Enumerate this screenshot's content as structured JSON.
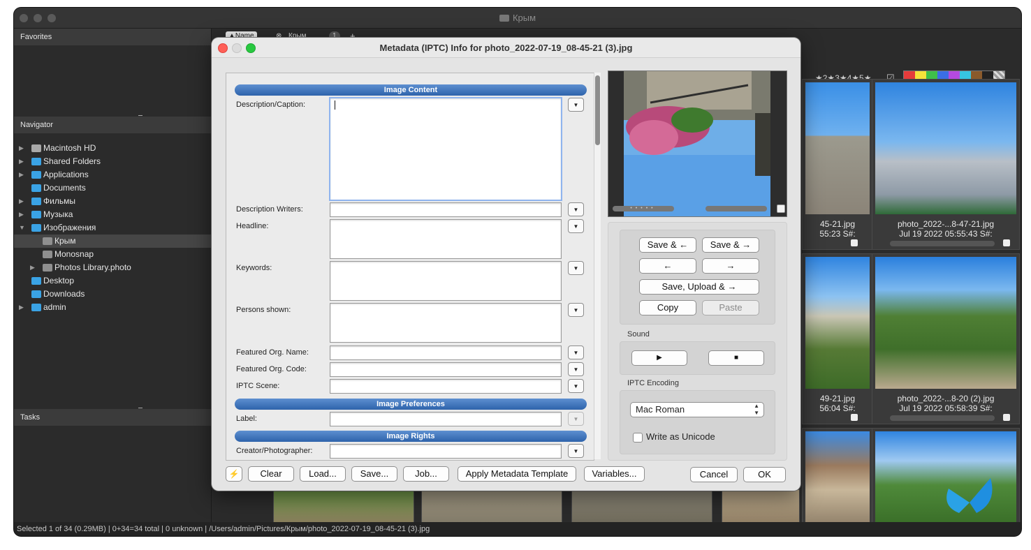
{
  "window": {
    "title": "Крым"
  },
  "panels": {
    "favorites": "Favorites",
    "navigator": "Navigator",
    "tasks": "Tasks"
  },
  "navigator_items": [
    {
      "label": "Macintosh HD",
      "icon": "hard-drive-icon",
      "arrow": "▶",
      "level": 0
    },
    {
      "label": "Shared Folders",
      "icon": "shared-folder-icon",
      "arrow": "▶",
      "level": 0
    },
    {
      "label": "Applications",
      "icon": "folder-icon",
      "arrow": "▶",
      "level": 0
    },
    {
      "label": "Documents",
      "icon": "folder-icon",
      "arrow": "",
      "level": 0
    },
    {
      "label": "Фильмы",
      "icon": "folder-icon",
      "arrow": "▶",
      "level": 0
    },
    {
      "label": "Музыка",
      "icon": "folder-icon",
      "arrow": "▶",
      "level": 0
    },
    {
      "label": "Изображения",
      "icon": "folder-icon",
      "arrow": "▼",
      "level": 0
    },
    {
      "label": "Крым",
      "icon": "folder-icon",
      "arrow": "",
      "level": 1,
      "selected": true
    },
    {
      "label": "Monosnap",
      "icon": "folder-icon",
      "arrow": "",
      "level": 1
    },
    {
      "label": "Photos Library.photo",
      "icon": "folder-icon",
      "arrow": "▶",
      "level": 1
    },
    {
      "label": "Desktop",
      "icon": "folder-icon",
      "arrow": "",
      "level": 0
    },
    {
      "label": "Downloads",
      "icon": "downloads-folder-icon",
      "arrow": "",
      "level": 0
    },
    {
      "label": "admin",
      "icon": "home-folder-icon",
      "arrow": "▶",
      "level": 0
    }
  ],
  "tabbar": {
    "sort": "▲Name",
    "tab": "Крым",
    "count": "1",
    "add": "+"
  },
  "rating_filter": "★2★3★4★5★",
  "color_labels": [
    "#e53b3b",
    "#f5e23a",
    "#3fbf4a",
    "#3b6ee5",
    "#b44ae0",
    "#36c5e0",
    "#8a5a2b",
    "#222222"
  ],
  "thumbnails": [
    {
      "caption1": "45-21.jpg",
      "caption2": "55:23 S#:"
    },
    {
      "caption1": "photo_2022-...8-47-21.jpg",
      "caption2": "Jul 19 2022 05:55:43 S#:"
    },
    {
      "caption1": "49-21.jpg",
      "caption2": "56:04 S#:"
    },
    {
      "caption1": "photo_2022-...8-20 (2).jpg",
      "caption2": "Jul 19 2022 05:58:39 S#:"
    }
  ],
  "status_text": "Selected 1 of 34 (0.29MB) | 0+34=34 total | 0 unknown | /Users/admin/Pictures/Крым/photo_2022-07-19_08-45-21 (3).jpg",
  "dialog": {
    "title": "Metadata (IPTC) Info for photo_2022-07-19_08-45-21 (3).jpg",
    "sections": {
      "content": "Image Content",
      "preferences": "Image Preferences",
      "rights": "Image Rights"
    },
    "fields": {
      "description": {
        "label": "Description/Caption:",
        "value": ""
      },
      "desc_writers": {
        "label": "Description Writers:",
        "value": ""
      },
      "headline": {
        "label": "Headline:",
        "value": ""
      },
      "keywords": {
        "label": "Keywords:",
        "value": ""
      },
      "persons": {
        "label": "Persons shown:",
        "value": ""
      },
      "org_name": {
        "label": "Featured Org. Name:",
        "value": ""
      },
      "org_code": {
        "label": "Featured Org. Code:",
        "value": ""
      },
      "iptc_scene": {
        "label": "IPTC Scene:",
        "value": ""
      },
      "label": {
        "label": "Label:",
        "value": ""
      },
      "creator": {
        "label": "Creator/Photographer:",
        "value": ""
      }
    },
    "nav_buttons": {
      "save_prev": "Save & ←",
      "save_next": "Save & →",
      "prev": "←",
      "next": "→",
      "save_upload_next": "Save, Upload & →",
      "copy": "Copy",
      "paste": "Paste"
    },
    "sound": {
      "label": "Sound",
      "play": "▶",
      "stop": "■"
    },
    "encoding": {
      "label": "IPTC Encoding",
      "value": "Mac Roman",
      "write_unicode": "Write as Unicode",
      "write_unicode_checked": false
    },
    "bottom_buttons": {
      "lightning": "⚡",
      "clear": "Clear",
      "load": "Load...",
      "save": "Save...",
      "job": "Job...",
      "apply_template": "Apply Metadata Template",
      "variables": "Variables...",
      "cancel": "Cancel",
      "ok": "OK"
    }
  }
}
